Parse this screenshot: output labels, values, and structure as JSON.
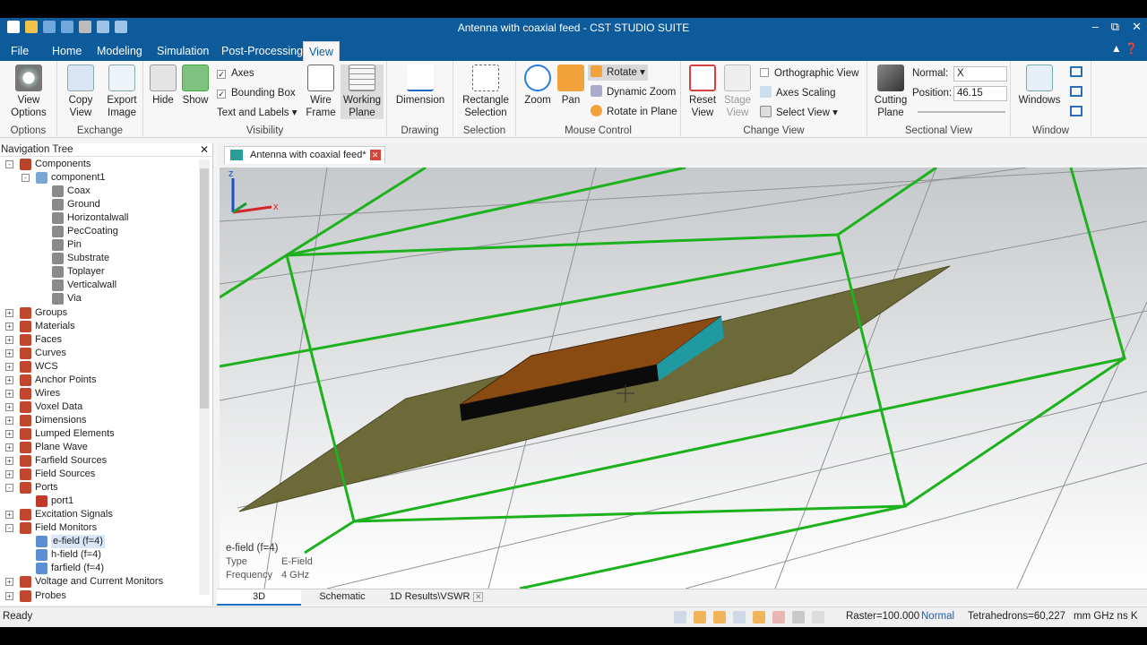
{
  "window": {
    "title": "Antenna with coaxial feed - CST STUDIO SUITE"
  },
  "ribbon_tabs": [
    "File",
    "Home",
    "Modeling",
    "Simulation",
    "Post-Processing",
    "View"
  ],
  "ribbon": {
    "options": {
      "view_options": "View\nOptions",
      "group": "Options"
    },
    "exchange": {
      "copy_view": "Copy\nView",
      "export_image": "Export\nImage",
      "group": "Exchange"
    },
    "visibility": {
      "hide": "Hide",
      "show": "Show",
      "axes": "Axes",
      "bounding_box": "Bounding Box",
      "text_labels": "Text and Labels",
      "wire_frame": "Wire\nFrame",
      "working_plane": "Working\nPlane",
      "group": "Visibility"
    },
    "drawing": {
      "dimension": "Dimension",
      "group": "Drawing"
    },
    "selection": {
      "rect_selection": "Rectangle\nSelection",
      "group": "Selection"
    },
    "mouse": {
      "zoom": "Zoom",
      "pan": "Pan",
      "rotate": "Rotate",
      "dynamic_zoom": "Dynamic Zoom",
      "rotate_plane": "Rotate in Plane",
      "group": "Mouse Control"
    },
    "change_view": {
      "reset_view": "Reset\nView",
      "stage_view": "Stage\nView",
      "ortho": "Orthographic View",
      "axes_scaling": "Axes Scaling",
      "select_view": "Select View",
      "group": "Change View"
    },
    "sectional": {
      "cutting_plane": "Cutting\nPlane",
      "normal_label": "Normal:",
      "normal_value": "X",
      "position_label": "Position:",
      "position_value": "46.15",
      "group": "Sectional View"
    },
    "window": {
      "windows": "Windows",
      "group": "Window"
    }
  },
  "nav": {
    "title": "Navigation Tree",
    "items": [
      "Components",
      "component1",
      "Coax",
      "Ground",
      "Horizontalwall",
      "PecCoating",
      "Pin",
      "Substrate",
      "Toplayer",
      "Verticalwall",
      "Via",
      "Groups",
      "Materials",
      "Faces",
      "Curves",
      "WCS",
      "Anchor Points",
      "Wires",
      "Voxel Data",
      "Dimensions",
      "Lumped Elements",
      "Plane Wave",
      "Farfield Sources",
      "Field Sources",
      "Ports",
      "port1",
      "Excitation Signals",
      "Field Monitors",
      "e-field (f=4)",
      "h-field (f=4)",
      "farfield (f=4)",
      "Voltage and Current Monitors",
      "Probes"
    ]
  },
  "doc_tab": "Antenna with coaxial feed*",
  "viewport": {
    "info_title": "e-field (f=4)",
    "info_type_label": "Type",
    "info_type_value": "E-Field",
    "info_freq_label": "Frequency",
    "info_freq_value": "4 GHz",
    "axis_x": "x",
    "axis_z": "z"
  },
  "bottom_tabs": [
    "3D",
    "Schematic",
    "1D Results\\VSWR"
  ],
  "status": {
    "ready": "Ready",
    "raster": "Raster=100.000",
    "mode": "Normal",
    "mesh": "Tetrahedrons=60,227",
    "units": "mm  GHz  ns  K"
  },
  "colors": {
    "accent": "#0d5b9b",
    "bbox": "#1db11d",
    "ground": "#6d6a3a",
    "substrate_top": "#8a4b12",
    "substrate_side": "#1f9aa0"
  }
}
